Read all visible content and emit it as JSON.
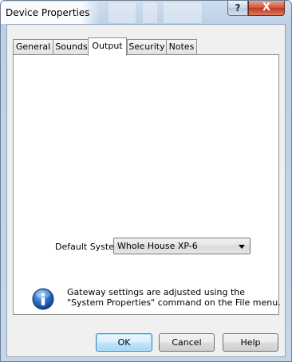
{
  "window": {
    "title": "Device Properties",
    "help_glyph": "?",
    "close_glyph": "X"
  },
  "tabs": [
    {
      "label": "General"
    },
    {
      "label": "Sounds"
    },
    {
      "label": "Output",
      "active": true
    },
    {
      "label": "Security"
    },
    {
      "label": "Notes"
    }
  ],
  "output": {
    "default_system_label": "Default System:",
    "default_system_value": "Whole House XP-6",
    "info_line1": "Gateway settings are adjusted using the",
    "info_line2": "\"System Properties\" command on the File menu."
  },
  "buttons": {
    "ok": "OK",
    "cancel": "Cancel",
    "help": "Help"
  },
  "colors": {
    "accent": "#3c7fb1",
    "close_button": "#c13a20",
    "info_icon": "#2b6fc4"
  },
  "icons": {
    "info": "info-icon",
    "help": "help-icon",
    "close": "close-icon",
    "dropdown": "chevron-down-icon"
  }
}
